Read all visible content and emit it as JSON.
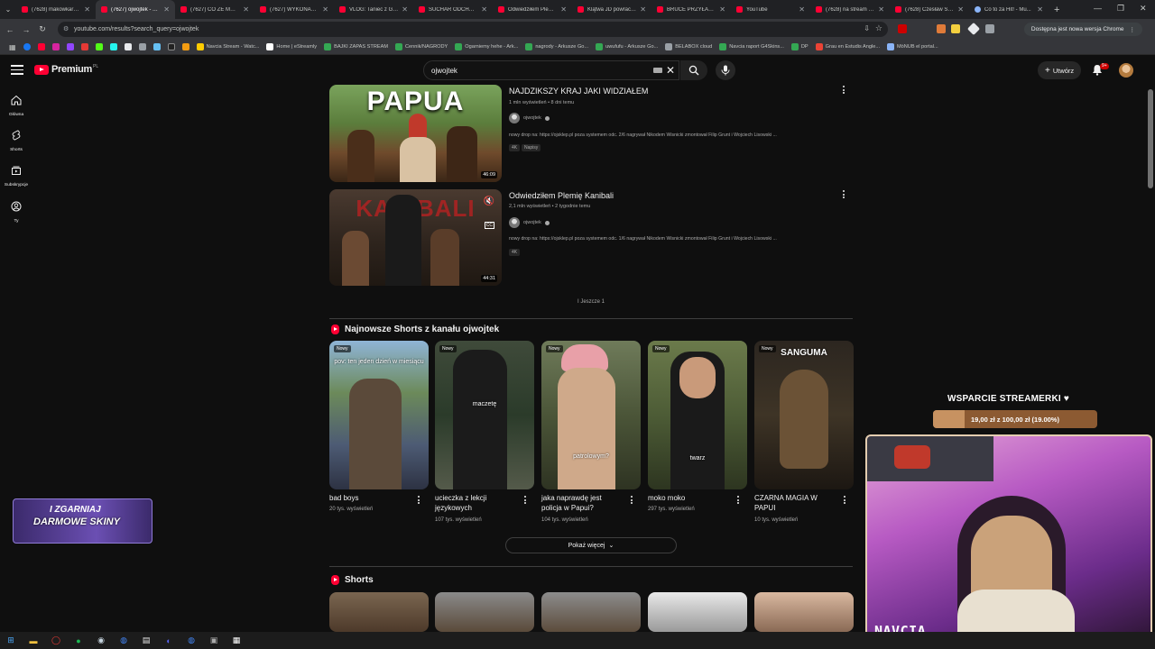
{
  "browser": {
    "tabs": [
      {
        "label": "(7628) makowkarna...",
        "active": false
      },
      {
        "label": "(7627) ojwojtek - Yo...",
        "active": true
      },
      {
        "label": "(7627) CO ZE MNA...",
        "active": false
      },
      {
        "label": "(7627) WYKONALE...",
        "active": false
      },
      {
        "label": "VLOG: Taniec z Gw...",
        "active": false
      },
      {
        "label": "SUCHAR ODCHOD...",
        "active": false
      },
      {
        "label": "Odwiedziłem Plemi...",
        "active": false
      },
      {
        "label": "Klątwa JD powraca...",
        "active": false
      },
      {
        "label": "BRUCE PRZYŁAPAN...",
        "active": false
      },
      {
        "label": "YouTube",
        "active": false
      },
      {
        "label": "(7628) na stream -...",
        "active": false
      },
      {
        "label": "(7628) Czesław Spi...",
        "active": false
      },
      {
        "label": "Co to za Hit! - Mu...",
        "active": false
      }
    ],
    "url": "youtube.com/results?search_query=ojwojtek",
    "update_notice": "Dostępna jest nowa wersja Chrome",
    "bookmarks": [
      {
        "label": "Navcia Stream - Watc...",
        "color": "#ffcc00"
      },
      {
        "label": "Home | eStreamly",
        "color": "#ffffff"
      },
      {
        "label": "BAJKI ZAPAS STREAM",
        "color": "#34a853"
      },
      {
        "label": "Cennik/NAGRODY",
        "color": "#34a853"
      },
      {
        "label": "Ogarniemy hehe - Ark...",
        "color": "#34a853"
      },
      {
        "label": "nagrody - Arkusze Go...",
        "color": "#34a853"
      },
      {
        "label": "uwufufu - Arkusze Go...",
        "color": "#34a853"
      },
      {
        "label": "BELABOX cloud",
        "color": "#9aa0a6"
      },
      {
        "label": "Navcia raport G4Skins...",
        "color": "#34a853"
      },
      {
        "label": "DP",
        "color": "#34a853"
      },
      {
        "label": "Grau en Estudis Angle...",
        "color": "#ea4335"
      },
      {
        "label": "MöNUB el portal...",
        "color": "#8ab4f8"
      }
    ]
  },
  "yt": {
    "brand": "Premium",
    "country": "PL",
    "search_value": "ojwojtek",
    "create_label": "Utwórz",
    "notif_count": "9+",
    "guide": [
      {
        "label": "Główna",
        "icon": "home-icon"
      },
      {
        "label": "Shorts",
        "icon": "shorts-icon"
      },
      {
        "label": "Subskrypcje",
        "icon": "subscriptions-icon"
      },
      {
        "label": "Ty",
        "icon": "you-icon"
      }
    ],
    "videos": [
      {
        "title": "NAJDZIKSZY KRAJ JAKI WIDZIAŁEM",
        "meta": "1 mln wyświetleń • 8 dni temu",
        "channel": "ojwojtek",
        "desc": "nowy drop na: https://ojsklep.pl poza systemem odc. 2/6 nagrywał Nikodem Wisnicki zmontował Filip Grunt i Wojciech Lisowski ...",
        "badges": [
          "4K",
          "Napisy"
        ],
        "duration": "46:09",
        "thumb_text": "PAPUA"
      },
      {
        "title": "Odwiedziłem Plemię Kanibali",
        "meta": "2,1 mln wyświetleń • 2 tygodnie temu",
        "channel": "ojwojtek",
        "desc": "nowy drop na: https://ojsklep.pl poza systemem odc. 1/6 nagrywał Nikodem Wisnicki zmontował Filip Grunt i Wojciech Lisowski ...",
        "badges": [
          "4K"
        ],
        "duration": "44:31",
        "thumb_text": "KANIBALI"
      }
    ],
    "more_results": "I Jeszcze 1",
    "shorts_section_title": "Najnowsze Shorts z kanału ojwojtek",
    "shorts": [
      {
        "badge": "Nowy",
        "caption": "pov: ten jeden dzień w miesiącu",
        "title": "bad boys",
        "views": "20 tys. wyświetleń"
      },
      {
        "badge": "Nowy",
        "caption": "maczetę",
        "title": "ucieczka z lekcji językowych",
        "views": "107 tys. wyświetleń"
      },
      {
        "badge": "Nowy",
        "caption": "patrolowym?",
        "title": "jaka naprawdę jest policja w Papui?",
        "views": "104 tys. wyświetleń"
      },
      {
        "badge": "Nowy",
        "caption": "twarz",
        "title": "moko moko",
        "views": "297 tys. wyświetleń"
      },
      {
        "badge": "Nowy",
        "caption": "SANGUMA",
        "title": "CZARNA MAGIA W PAPUI",
        "views": "10 tys. wyświetleń"
      }
    ],
    "show_more_label": "Pokaż więcej",
    "shorts_title_2": "Shorts"
  },
  "overlay": {
    "promo_line1": "I ZGARNIAJ",
    "promo_line2": "DARMOWE SKINY",
    "donate_title": "WSPARCIE STREAMERKI ♥",
    "donate_text": "19,00 zł z 100,00 zł (19.00%)",
    "donate_progress": 0.19,
    "webcam_name": "NAVCIA"
  }
}
